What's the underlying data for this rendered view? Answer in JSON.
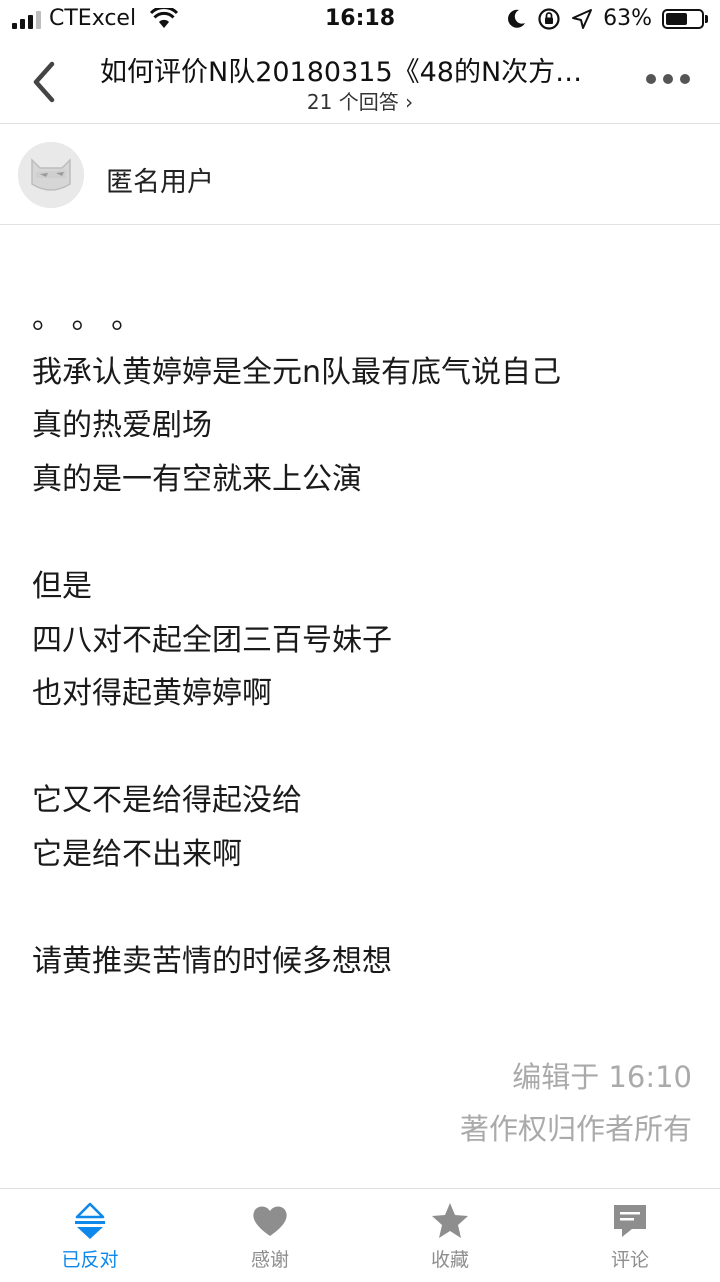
{
  "status_bar": {
    "carrier": "CTExcel",
    "time": "16:18",
    "battery": "63%",
    "battery_level": 0.63
  },
  "nav": {
    "title": "如何评价N队20180315《48的N次方…",
    "subtitle": "21 个回答 ›"
  },
  "author": {
    "name": "匿名用户"
  },
  "answer": {
    "lines": [
      "。 。 。",
      "我承认黄婷婷是全元n队最有底气说自己",
      "真的热爱剧场",
      "真的是一有空就来上公演",
      "",
      "但是",
      "四八对不起全团三百号妹子",
      "也对得起黄婷婷啊",
      "",
      "它又不是给得起没给",
      "它是给不出来啊",
      "",
      "请黄推卖苦情的时候多想想"
    ],
    "edited": "编辑于 16:10",
    "copyright": "著作权归作者所有"
  },
  "tabs": [
    {
      "label": "已反对",
      "icon": "oppose-icon",
      "active": true
    },
    {
      "label": "感谢",
      "icon": "heart-icon",
      "active": false
    },
    {
      "label": "收藏",
      "icon": "star-icon",
      "active": false
    },
    {
      "label": "评论",
      "icon": "comment-icon",
      "active": false
    }
  ],
  "colors": {
    "accent": "#0f88eb",
    "inactive_icon": "#8e8e8e",
    "meta_text": "#aaaaaa"
  }
}
